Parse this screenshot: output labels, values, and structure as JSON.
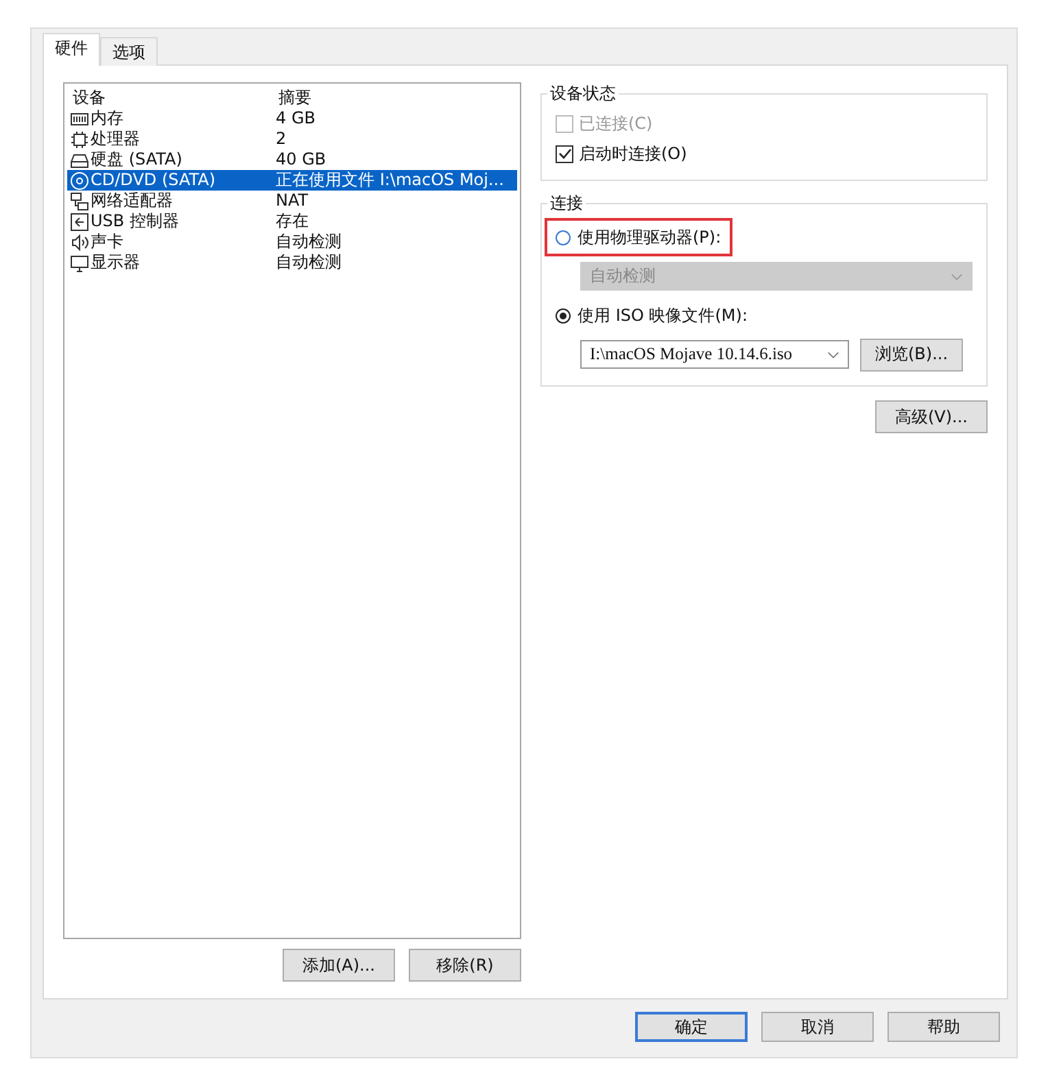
{
  "tabs": [
    {
      "label": "硬件",
      "selected": true
    },
    {
      "label": "选项",
      "selected": false
    }
  ],
  "device_list": {
    "columns": [
      "设备",
      "摘要"
    ],
    "rows": [
      {
        "kind": "memory",
        "device": "内存",
        "summary": "4 GB",
        "selected": false
      },
      {
        "kind": "cpu",
        "device": "处理器",
        "summary": "2",
        "selected": false
      },
      {
        "kind": "disk",
        "device": "硬盘 (SATA)",
        "summary": "40 GB",
        "selected": false
      },
      {
        "kind": "cd",
        "device": "CD/DVD (SATA)",
        "summary": "正在使用文件 I:\\macOS Moj...",
        "selected": true
      },
      {
        "kind": "network",
        "device": "网络适配器",
        "summary": "NAT",
        "selected": false
      },
      {
        "kind": "usb",
        "device": "USB 控制器",
        "summary": "存在",
        "selected": false
      },
      {
        "kind": "sound",
        "device": "声卡",
        "summary": "自动检测",
        "selected": false
      },
      {
        "kind": "display",
        "device": "显示器",
        "summary": "自动检测",
        "selected": false
      }
    ]
  },
  "list_buttons": [
    "添加(A)...",
    "移除(R)"
  ],
  "device_status": {
    "title": "设备状态",
    "options": [
      {
        "label": "已连接(C)",
        "checked": false,
        "disabled": true
      },
      {
        "label": "启动时连接(O)",
        "checked": true,
        "disabled": false
      }
    ]
  },
  "connection": {
    "title": "连接",
    "physical": {
      "label": "使用物理驱动器(P):",
      "selected": false,
      "highlighted": true,
      "dropdown": {
        "value": "自动检测",
        "disabled": true
      }
    },
    "iso": {
      "label": "使用 ISO 映像文件(M):",
      "selected": true,
      "dropdown": {
        "value": "I:\\macOS Mojave 10.14.6.iso",
        "disabled": false
      },
      "browse": "浏览(B)..."
    }
  },
  "advanced_button": "高级(V)...",
  "dialog_buttons": [
    {
      "label": "确定",
      "default": true
    },
    {
      "label": "取消",
      "default": false
    },
    {
      "label": "帮助",
      "default": false
    }
  ]
}
